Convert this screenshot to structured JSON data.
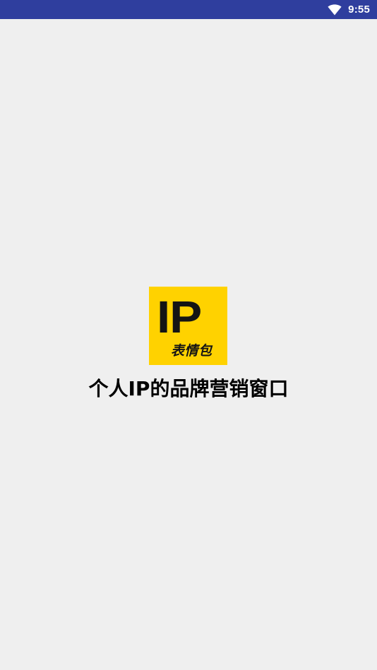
{
  "status_bar": {
    "time": "9:55",
    "icons": [
      "wifi-icon"
    ],
    "background_color": "#2f3e9e"
  },
  "splash": {
    "logo": {
      "main_text": "IP",
      "sub_text": "表情包",
      "background_color": "#ffd200"
    },
    "slogan": "个人IP的品牌营销窗口",
    "background_color": "#efefef"
  }
}
